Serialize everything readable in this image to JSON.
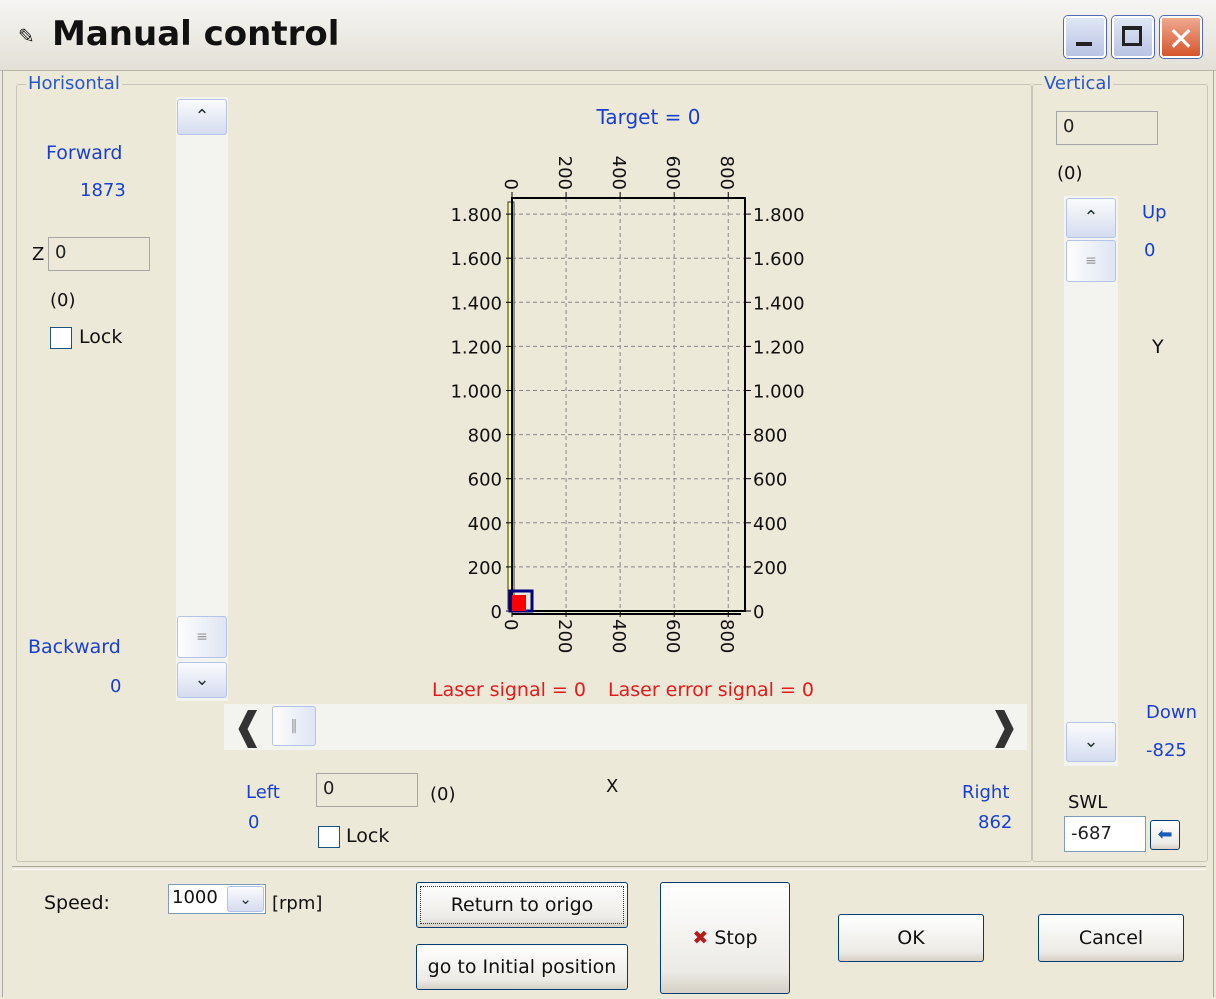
{
  "window": {
    "title": "Manual control"
  },
  "horizontal": {
    "legend": "Horisontal",
    "forward_label": "Forward",
    "forward_value": "1873",
    "z_label": "Z",
    "z_value": "0",
    "z_paren": "(0)",
    "lock_label": "Lock",
    "backward_label": "Backward",
    "backward_value": "0",
    "left_label": "Left",
    "left_value": "0",
    "x_field": "0",
    "x_paren": "(0)",
    "x_label": "X",
    "x_lock_label": "Lock",
    "right_label": "Right",
    "right_value": "862"
  },
  "vertical": {
    "legend": "Vertical",
    "field_value": "0",
    "paren": "(0)",
    "up_label": "Up",
    "up_value": "0",
    "y_label": "Y",
    "down_label": "Down",
    "down_value": "-825",
    "swl_label": "SWL",
    "swl_value": "-687"
  },
  "chart_data": {
    "type": "scatter",
    "title": "Target = 0",
    "bottom_caption_1": "Laser signal = 0",
    "bottom_caption_2": "Laser error signal = 0",
    "xlim": [
      0,
      862
    ],
    "ylim": [
      0,
      1873
    ],
    "x_ticks": [
      "0",
      "200",
      "400",
      "600",
      "800"
    ],
    "y_ticks_left": [
      "0",
      "200",
      "400",
      "600",
      "800",
      "1.000",
      "1.200",
      "1.400",
      "1.600",
      "1.800"
    ],
    "y_ticks_right": [
      "0",
      "200",
      "400",
      "600",
      "800",
      "1.000",
      "1.200",
      "1.400",
      "1.600",
      "1.800"
    ],
    "position": {
      "x": 0,
      "y": 0
    },
    "colors": {
      "marker": "#ff0000",
      "marker_border": "#000080",
      "bar": "#ffff80",
      "frame": "#000000",
      "grid": "#888888"
    }
  },
  "controls": {
    "speed_label": "Speed:",
    "speed_value": "1000",
    "speed_unit": "[rpm]",
    "return_button": "Return to origo",
    "initial_button": "go to Initial position",
    "stop_button": "Stop",
    "ok_button": "OK",
    "cancel_button": "Cancel"
  }
}
